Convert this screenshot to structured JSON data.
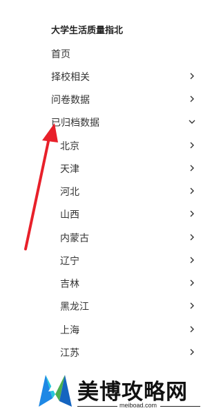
{
  "nav": {
    "title": "大学生活质量指北",
    "items": [
      {
        "label": "首页",
        "chevron": "none"
      },
      {
        "label": "择校相关",
        "chevron": "right"
      },
      {
        "label": "问卷数据",
        "chevron": "right"
      },
      {
        "label": "已归档数据",
        "chevron": "down"
      }
    ],
    "subitems": [
      {
        "label": "北京"
      },
      {
        "label": "天津"
      },
      {
        "label": "河北"
      },
      {
        "label": "山西"
      },
      {
        "label": "内蒙古"
      },
      {
        "label": "辽宁"
      },
      {
        "label": "吉林"
      },
      {
        "label": "黑龙江"
      },
      {
        "label": "上海"
      },
      {
        "label": "江苏"
      }
    ]
  },
  "annotation": {
    "arrow_color": "#e8202a"
  },
  "watermark": {
    "name": "美博攻略网",
    "url": "meiboad.com",
    "colors": {
      "mark_blue": "#1e88e5",
      "mark_green": "#4caf50",
      "mark_cyan": "#26c6da"
    }
  }
}
